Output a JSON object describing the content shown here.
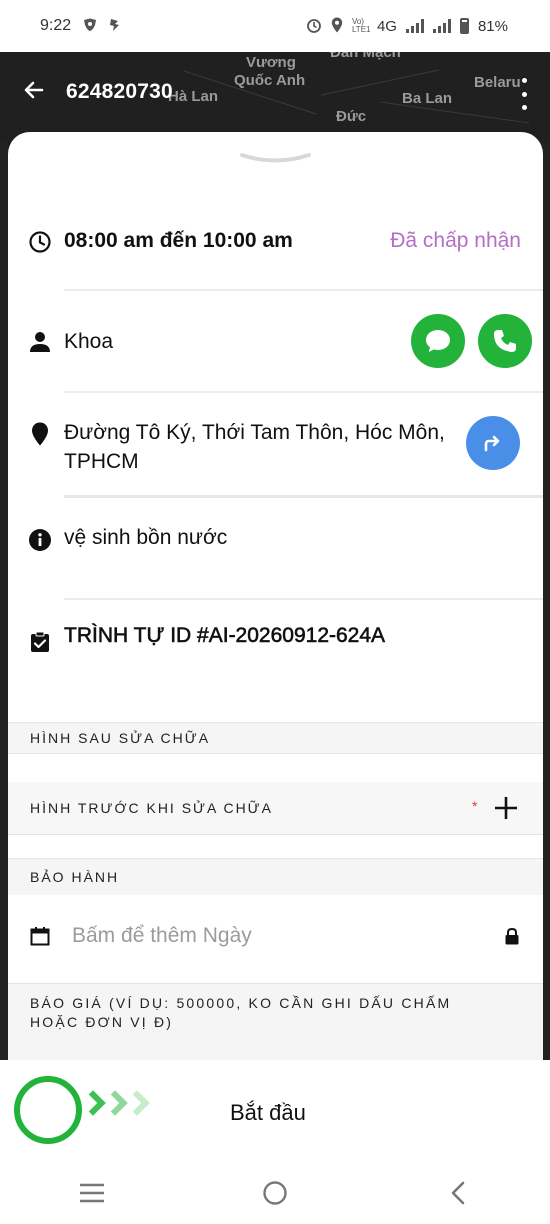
{
  "status_bar": {
    "time": "9:22",
    "network_label": "Vo) LTE1",
    "network_type": "4G",
    "battery": "81%"
  },
  "map": {
    "labels": [
      "Vương",
      "Quốc Anh",
      "Hà Lan",
      "Ba Lan",
      "Đức",
      "Belaru",
      "Đan Mạch"
    ]
  },
  "header": {
    "title": "624820730",
    "back_icon": "arrow-left-icon",
    "more_icon": "more-vertical-icon"
  },
  "job": {
    "time_range": "08:00 am đến 10:00 am",
    "status": "Đã chấp nhận",
    "customer_name": "Khoa",
    "address": "Đường Tô Ký, Thới Tam Thôn, Hóc Môn, TPHCM",
    "description": "vệ sinh bồn nước",
    "sequence": "TRÌNH TỰ ID #AI-20260912-624A"
  },
  "sections": {
    "after_repair": "HÌNH SAU SỬA CHỮA",
    "before_repair": "HÌNH TRƯỚC KHI SỬA CHỮA",
    "required_mark": "*",
    "warranty": "BẢO HÀNH",
    "warranty_placeholder": "Bấm để thêm Ngày",
    "quote": "BÁO GIÁ (VÍ DỤ: 500000, KO CẦN GHI DẤU CHẤM HOẶC ĐƠN VỊ Đ)"
  },
  "action": {
    "start_label": "Bắt đầu"
  },
  "colors": {
    "status_purple": "#b46ec6",
    "green": "#23b33a",
    "blue": "#4a8fe7"
  }
}
